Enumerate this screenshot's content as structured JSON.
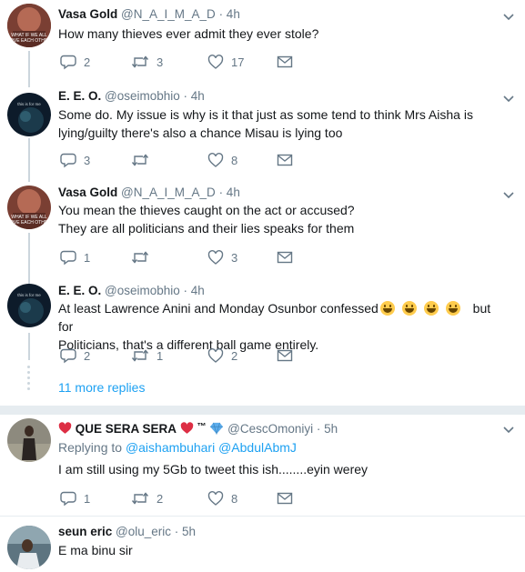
{
  "tweets": [
    {
      "name": "Vasa Gold",
      "handle": "@N_A_I_M_A_D",
      "time": "· 4h",
      "text": [
        "How many thieves ever admit they ever stole?"
      ],
      "replies": "2",
      "retweets": "3",
      "likes": "17"
    },
    {
      "name": "E. E. O.",
      "handle": "@oseimobhio",
      "time": "· 4h",
      "text": [
        "Some do. My issue is why is it that just as some tend to think Mrs Aisha is",
        "lying/guilty there's also a chance Misau is lying too"
      ],
      "replies": "3",
      "retweets": "",
      "likes": "8"
    },
    {
      "name": "Vasa Gold",
      "handle": "@N_A_I_M_A_D",
      "time": "· 4h",
      "text": [
        "You mean the thieves caught on the act or accused?",
        "They are all politicians and their lies speaks for them"
      ],
      "replies": "1",
      "retweets": "",
      "likes": "3"
    },
    {
      "name": "E. E. O.",
      "handle": "@oseimobhio",
      "time": "· 4h",
      "text": [
        "At least Lawrence Anini and Monday Osunbor confessed",
        "but for",
        "Politicians, that's a different ball game entirely."
      ],
      "replies": "2",
      "retweets": "1",
      "likes": "2"
    },
    {
      "name": "QUE SERA SERA",
      "name_symbol": "™",
      "handle": "@CescOmoniyi",
      "time": "· 5h",
      "replying_prefix": "Replying to",
      "replying_to": [
        "@aishambuhari",
        "@AbdulAbmJ"
      ],
      "text": [
        "I am still using my 5Gb to tweet this ish........eyin werey"
      ],
      "replies": "1",
      "retweets": "2",
      "likes": "8"
    },
    {
      "name": "seun eric",
      "handle": "@olu_eric",
      "time": "· 5h",
      "text": [
        "E ma binu sir"
      ]
    }
  ],
  "more_replies": "11 more replies",
  "icons": {
    "reply": "reply-icon",
    "retweet": "retweet-icon",
    "like": "heart-icon",
    "message": "message-icon",
    "caret": "chevron-down-icon",
    "heart_emoji": "red-heart-emoji",
    "diamond_emoji": "blue-diamond-emoji",
    "smile_emoji": "grinning-face-emoji"
  },
  "colors": {
    "text": "#14171a",
    "secondary": "#657786",
    "link": "#1da1f2",
    "divider": "#e6ecf0",
    "thread_line": "#ccd6dd"
  }
}
